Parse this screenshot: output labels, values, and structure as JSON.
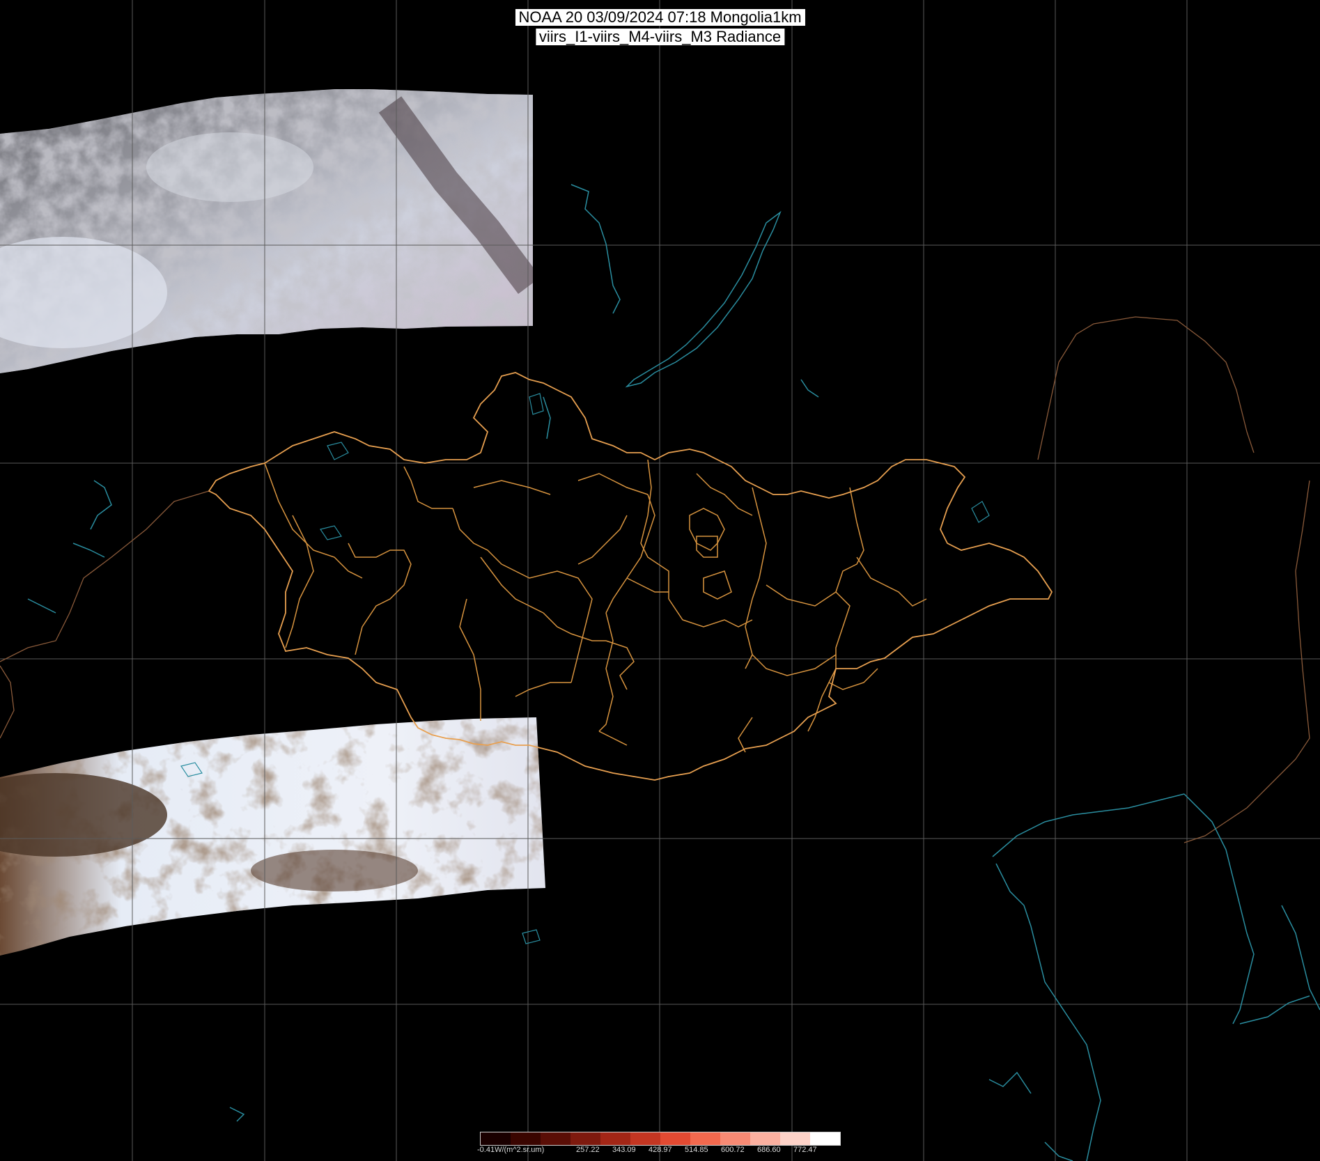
{
  "title": {
    "line1": "NOAA 20 03/09/2024 07:18 Mongolia1km",
    "line2": "viirs_I1-viirs_M4-viirs_M3 Radiance"
  },
  "legend": {
    "labels": [
      "-0.41W/(m^2.sr.um)",
      "257.22",
      "343.09",
      "428.97",
      "514.85",
      "600.72",
      "686.60",
      "772.47"
    ],
    "colors": [
      "#1a0000",
      "#3a0500",
      "#5a0e06",
      "#7e1a0e",
      "#a32616",
      "#c43622",
      "#e24a32",
      "#f2694e",
      "#f78a74",
      "#fbb0a0",
      "#fdd2c8",
      "#ffffff"
    ]
  },
  "colors": {
    "background": "#000000",
    "grid": "#5a5a5a",
    "mongolia_border": "#e8a050",
    "province_border": "#d8943f",
    "coastline": "#2a8ea0",
    "country_border": "#8a5a3a"
  }
}
